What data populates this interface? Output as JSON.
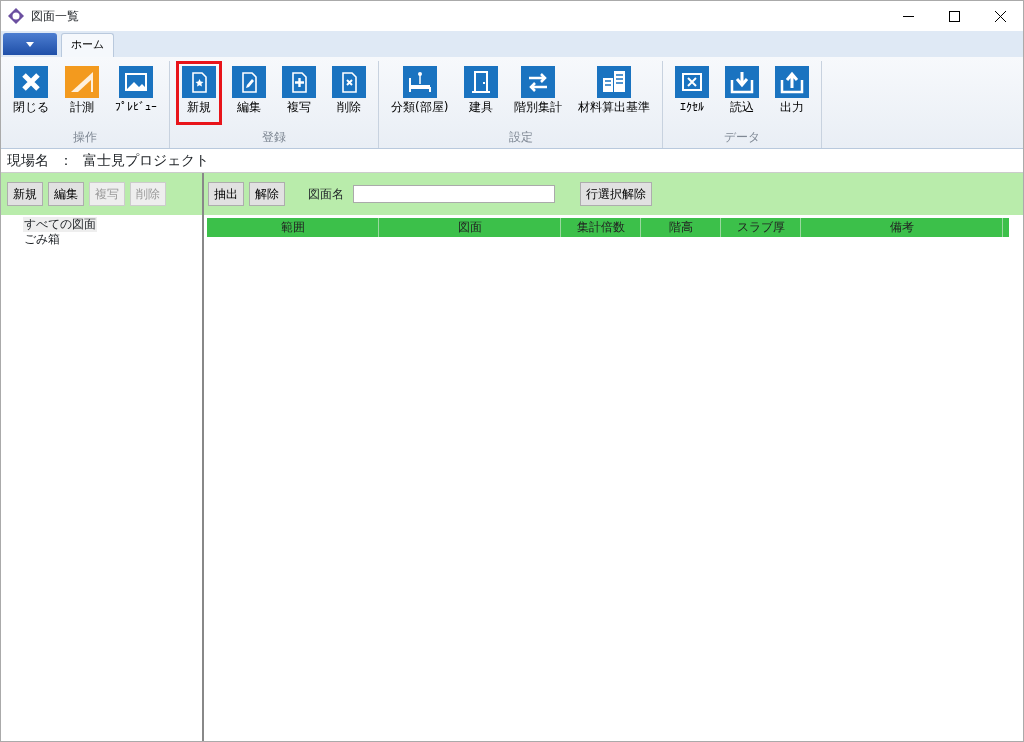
{
  "window": {
    "title": "図面一覧"
  },
  "ribbon_tabs": [
    {
      "label": "ホーム",
      "selected": true
    }
  ],
  "ribbon_groups": [
    {
      "label": "操作",
      "buttons": [
        {
          "label": "閉じる",
          "color": "#1a73c0",
          "highlighted": false
        },
        {
          "label": "計測",
          "color": "#f39a1e",
          "highlighted": false
        },
        {
          "label": "ﾌﾟﾚﾋﾞｭｰ",
          "color": "#1a73c0",
          "highlighted": false
        }
      ]
    },
    {
      "label": "登録",
      "buttons": [
        {
          "label": "新規",
          "color": "#1a73c0",
          "highlighted": true
        },
        {
          "label": "編集",
          "color": "#1a73c0",
          "highlighted": false
        },
        {
          "label": "複写",
          "color": "#1a73c0",
          "highlighted": false
        },
        {
          "label": "削除",
          "color": "#1a73c0",
          "highlighted": false
        }
      ]
    },
    {
      "label": "設定",
      "buttons": [
        {
          "label": "分類(部屋)",
          "color": "#1a73c0",
          "highlighted": false
        },
        {
          "label": "建具",
          "color": "#1a73c0",
          "highlighted": false
        },
        {
          "label": "階別集計",
          "color": "#1a73c0",
          "highlighted": false
        },
        {
          "label": "材料算出基準",
          "color": "#1a73c0",
          "highlighted": false
        }
      ]
    },
    {
      "label": "データ",
      "buttons": [
        {
          "label": "ｴｸｾﾙ",
          "color": "#1a73c0",
          "highlighted": false
        },
        {
          "label": "読込",
          "color": "#1a73c0",
          "highlighted": false
        },
        {
          "label": "出力",
          "color": "#1a73c0",
          "highlighted": false
        }
      ]
    }
  ],
  "site": {
    "label": "現場名",
    "separator": "：",
    "value": "富士見プロジェクト"
  },
  "left_toolbar": [
    {
      "label": "新規",
      "disabled": false
    },
    {
      "label": "編集",
      "disabled": false
    },
    {
      "label": "複写",
      "disabled": true
    },
    {
      "label": "削除",
      "disabled": true
    }
  ],
  "filter_toolbar": {
    "buttons": [
      {
        "label": "抽出"
      },
      {
        "label": "解除"
      }
    ],
    "field_label": "図面名",
    "clear_button": "行選択解除"
  },
  "tree": [
    {
      "label": "すべての図面",
      "selected": true
    },
    {
      "label": "ごみ箱",
      "selected": false
    }
  ],
  "table": {
    "columns": [
      "範囲",
      "図面",
      "集計倍数",
      "階高",
      "スラブ厚",
      "備考"
    ]
  }
}
